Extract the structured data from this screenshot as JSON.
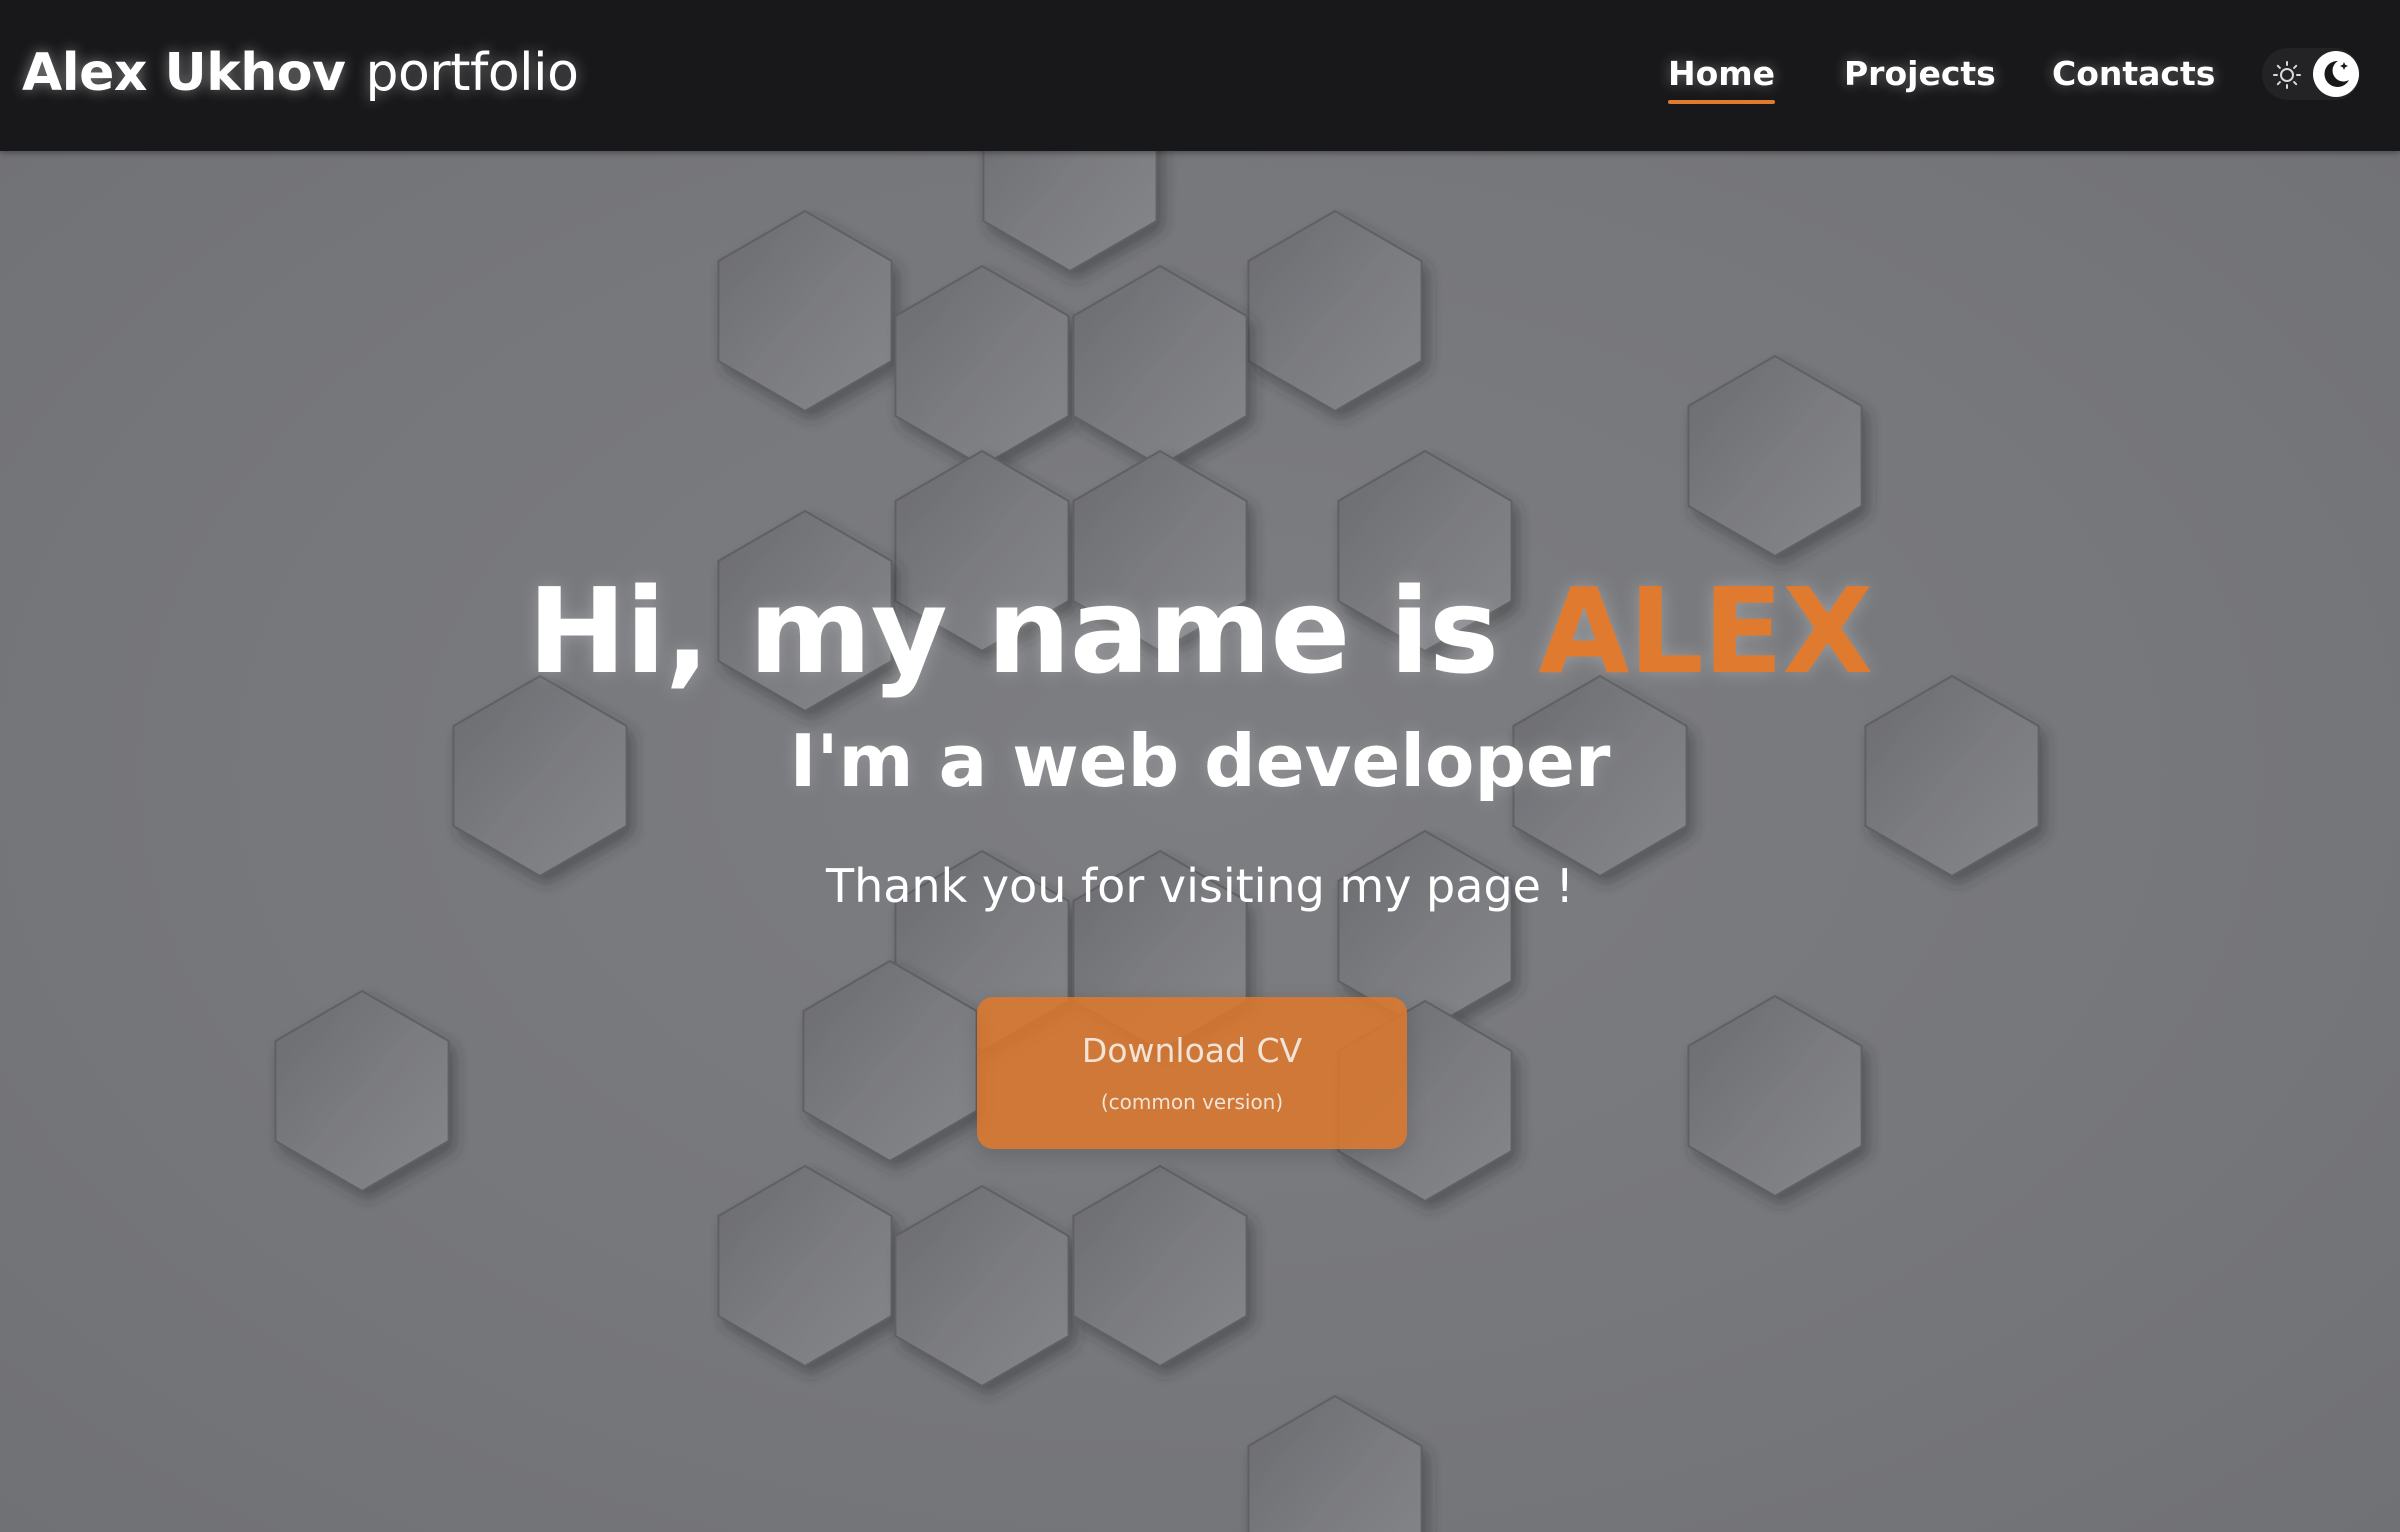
{
  "header": {
    "brand_name": "Alex Ukhov",
    "brand_sub": "portfolio",
    "nav": [
      {
        "label": "Home",
        "active": true
      },
      {
        "label": "Projects",
        "active": false
      },
      {
        "label": "Contacts",
        "active": false
      }
    ],
    "theme_toggle": {
      "icons": [
        "sun-icon",
        "moon-icon"
      ],
      "state": "dark"
    }
  },
  "hero": {
    "headline_prefix": "Hi, my name is",
    "headline_name": "ALEX",
    "subheadline": "I'm a web developer",
    "tagline": "Thank you for visiting my page !",
    "cta": {
      "label": "Download CV",
      "sublabel": "(common version)"
    }
  },
  "colors": {
    "accent": "#e07a2e",
    "header_bg": "#18181a",
    "hero_bg": "#77787c",
    "text": "#ffffff"
  }
}
